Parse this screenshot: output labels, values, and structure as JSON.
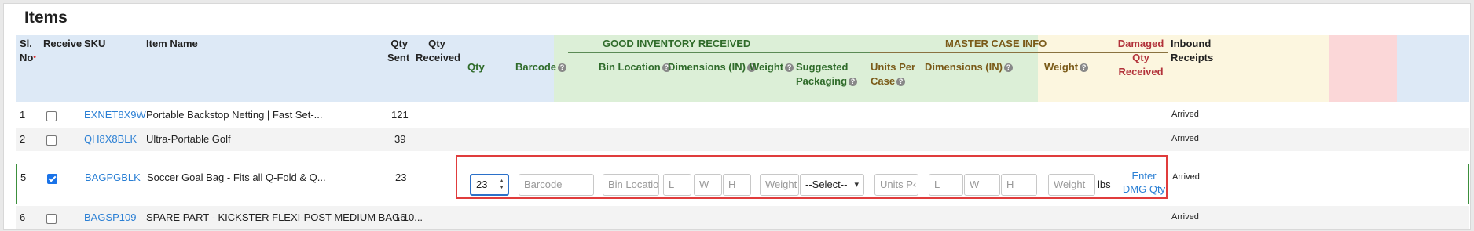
{
  "section_title": "Items",
  "headers": {
    "sl_no": [
      "Sl.",
      "No"
    ],
    "receive": "Receive",
    "sku": "SKU",
    "item_name": "Item Name",
    "qty_sent": [
      "Qty",
      "Sent"
    ],
    "qty_received": [
      "Qty",
      "Received"
    ],
    "good_inventory": "GOOD INVENTORY RECEIVED",
    "gi_qty": "Qty",
    "gi_barcode": "Barcode",
    "gi_bin_location": "Bin Location",
    "gi_dimensions": "Dimensions (IN)",
    "gi_weight": "Weight",
    "gi_suggested_packaging": [
      "Suggested",
      "Packaging"
    ],
    "master_case": "MASTER CASE INFO",
    "mc_units_per_case": [
      "Units Per",
      "Case"
    ],
    "mc_dimensions": "Dimensions (IN)",
    "mc_weight": "Weight",
    "damaged": [
      "Damaged",
      "Qty",
      "Received"
    ],
    "inbound_receipts": [
      "Inbound",
      "Receipts"
    ]
  },
  "rows": [
    {
      "sl": "1",
      "checked": false,
      "sku": "EXNET8X9W",
      "name": "Portable Backstop Netting | Fast Set-...",
      "qty_sent": "121",
      "status": "Arrived"
    },
    {
      "sl": "2",
      "checked": false,
      "sku": "QH8X8BLK",
      "name": "Ultra-Portable Golf",
      "qty_sent": "39",
      "status": "Arrived"
    },
    {
      "sl": "5",
      "checked": true,
      "sku": "BAGPGBLK",
      "name": "Soccer Goal Bag - Fits all Q-Fold & Q...",
      "qty_sent": "23",
      "status": "Arrived"
    },
    {
      "sl": "6",
      "checked": false,
      "sku": "BAGSP109",
      "name": "SPARE PART - KICKSTER FLEXI-POST MEDIUM BAG 10...",
      "qty_sent": "16",
      "status": "Arrived"
    }
  ],
  "edit_row": {
    "qty_value": "23",
    "barcode_placeholder": "Barcode",
    "bin_location_placeholder": "Bin Location",
    "l_placeholder": "L",
    "w_placeholder": "W",
    "h_placeholder": "H",
    "weight_placeholder": "Weight",
    "packaging_selected": "--Select--",
    "units_placeholder": "Units P‹",
    "mc_l_placeholder": "L",
    "mc_w_placeholder": "W",
    "mc_h_placeholder": "H",
    "mc_weight_placeholder": "Weight",
    "weight_unit": "lbs",
    "dmg_link": [
      "Enter",
      "DMG Qty"
    ]
  }
}
